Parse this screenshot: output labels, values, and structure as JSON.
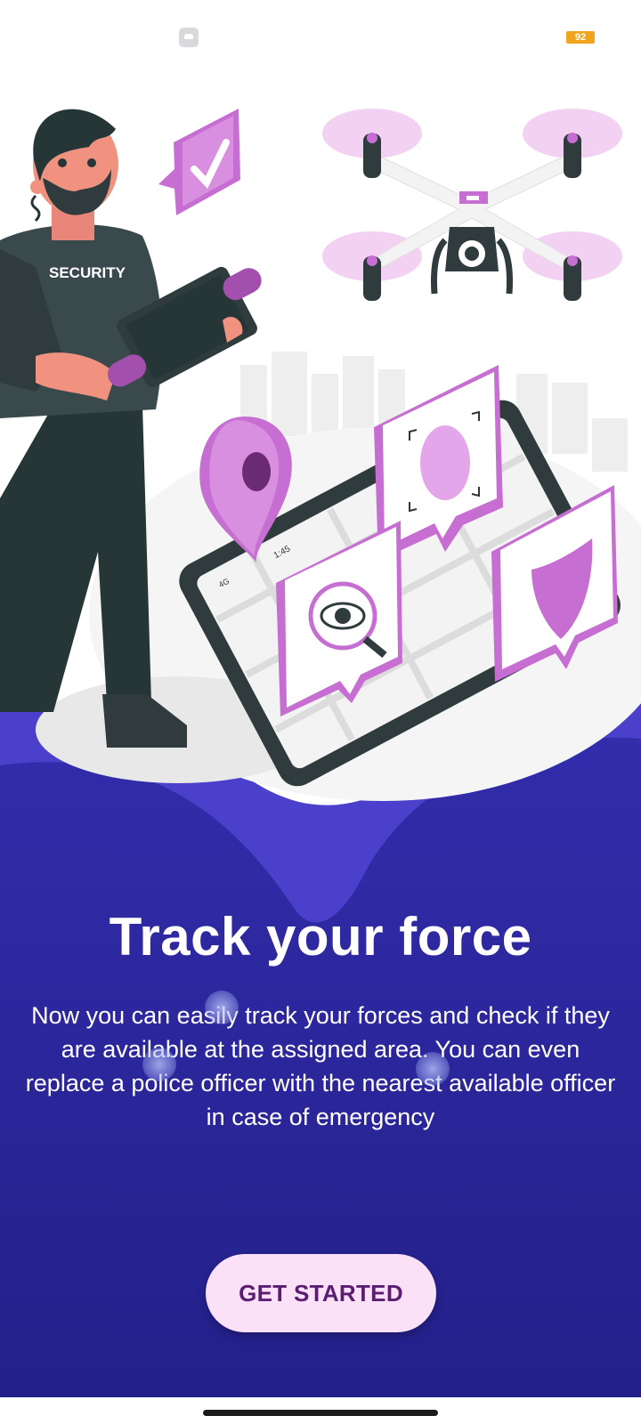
{
  "status_bar": {
    "app_icon": "android-app-icon",
    "battery_level": "92",
    "battery_color": "#f1a51e"
  },
  "illustration": {
    "badge_text": "SECURITY",
    "phone_time": "1:45",
    "phone_network": "4G"
  },
  "onboarding": {
    "title": "Track your force",
    "description": "Now you can easily track your forces and check if they are available at the assigned area. You can even replace a police officer with the nearest available officer in case of emergency",
    "cta_label": "GET STARTED"
  },
  "colors": {
    "hero_primary": "#2d2a9f",
    "hero_wave": "#4940c9",
    "accent_magenta": "#c76ed2",
    "button_bg": "#fbe1f8",
    "button_text": "#5a1d72"
  }
}
